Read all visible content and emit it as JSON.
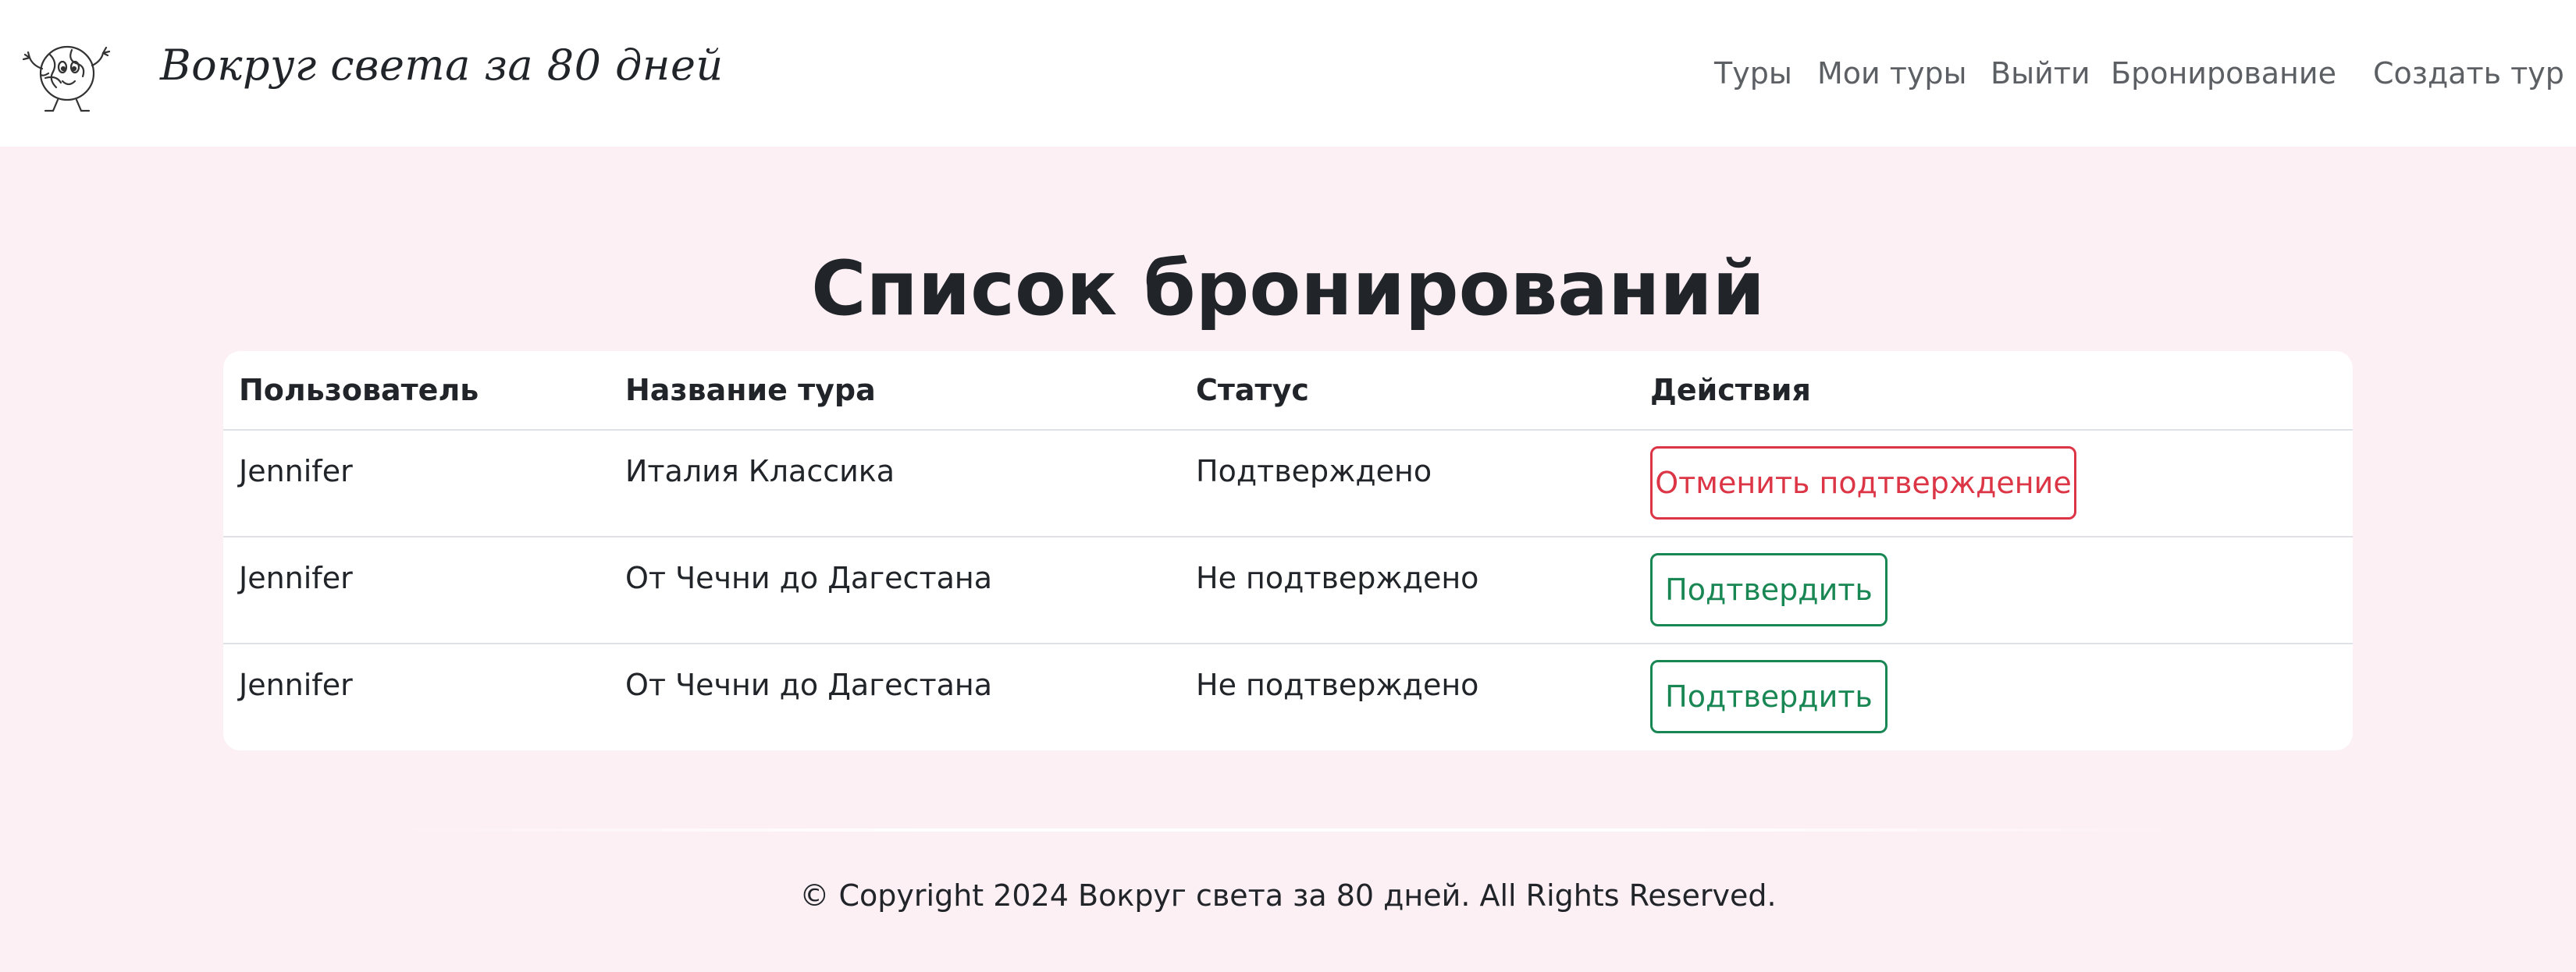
{
  "navbar": {
    "brand": "Вокруг света за 80 дней",
    "logo_icon": "globe-cartoon-icon",
    "links": [
      "Туры",
      "Мои туры",
      "Выйти",
      "Бронирование",
      "Создать тур"
    ]
  },
  "page": {
    "title": "Список бронирований"
  },
  "table": {
    "headers": [
      "Пользователь",
      "Название тура",
      "Статус",
      "Действия"
    ],
    "rows": [
      {
        "user": "Jennifer",
        "tour": "Италия Классика",
        "status": "Подтверждено",
        "action": "Отменить подтверждение"
      },
      {
        "user": "Jennifer",
        "tour": "От Чечни до Дагестана",
        "status": "Не подтверждено",
        "action": "Подтвердить"
      },
      {
        "user": "Jennifer",
        "tour": "От Чечни до Дагестана",
        "status": "Не подтверждено",
        "action": "Подтвердить"
      }
    ]
  },
  "footer": {
    "text": "© Copyright 2024 Вокруг света за 80 дней. All Rights Reserved."
  },
  "colors": {
    "page_background": "#fcf0f4",
    "danger": "#dc3545",
    "success": "#198754"
  }
}
